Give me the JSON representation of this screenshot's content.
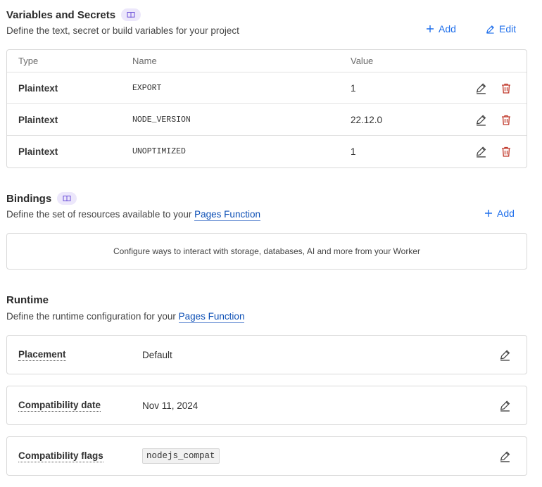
{
  "variables": {
    "title": "Variables and Secrets",
    "description": "Define the text, secret or build variables for your project",
    "add_label": "Add",
    "edit_label": "Edit",
    "columns": {
      "type": "Type",
      "name": "Name",
      "value": "Value"
    },
    "rows": [
      {
        "type": "Plaintext",
        "name": "EXPORT",
        "value": "1"
      },
      {
        "type": "Plaintext",
        "name": "NODE_VERSION",
        "value": "22.12.0"
      },
      {
        "type": "Plaintext",
        "name": "UNOPTIMIZED",
        "value": "1"
      }
    ]
  },
  "bindings": {
    "title": "Bindings",
    "description_prefix": "Define the set of resources available to your ",
    "description_link": "Pages Function",
    "add_label": "Add",
    "empty_message": "Configure ways to interact with storage, databases, AI and more from your Worker"
  },
  "runtime": {
    "title": "Runtime",
    "description_prefix": "Define the runtime configuration for your ",
    "description_link": "Pages Function",
    "settings": [
      {
        "label": "Placement",
        "value": "Default"
      },
      {
        "label": "Compatibility date",
        "value": "Nov 11, 2024"
      },
      {
        "label": "Compatibility flags",
        "value": "nodejs_compat"
      }
    ]
  },
  "colors": {
    "accent": "#1f6feb",
    "danger": "#c0392b",
    "badge_bg": "#ece7fb"
  }
}
